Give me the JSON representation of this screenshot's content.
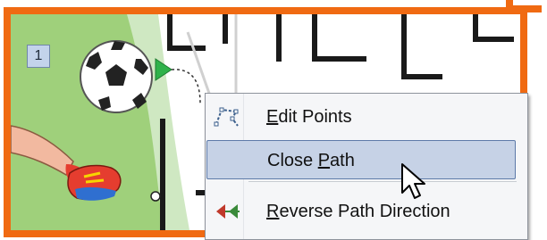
{
  "slide": {
    "number": "1"
  },
  "context_menu": {
    "items": [
      {
        "label_pre": "",
        "label_accel": "E",
        "label_post": "dit Points",
        "icon": "edit-points-icon",
        "highlighted": false
      },
      {
        "label_pre": "Close ",
        "label_accel": "P",
        "label_post": "ath",
        "icon": "",
        "highlighted": true
      },
      {
        "label_pre": "",
        "label_accel": "R",
        "label_post": "everse Path Direction",
        "icon": "reverse-path-direction-icon",
        "highlighted": false
      }
    ]
  },
  "colors": {
    "frame": "#f06a12",
    "grass": "#9fd07b",
    "highlight": "#c6d2e6",
    "path_arrow": "#2fb24a",
    "reverse_arrow_green": "#3a8a3a",
    "reverse_arrow_red": "#c0392b"
  }
}
